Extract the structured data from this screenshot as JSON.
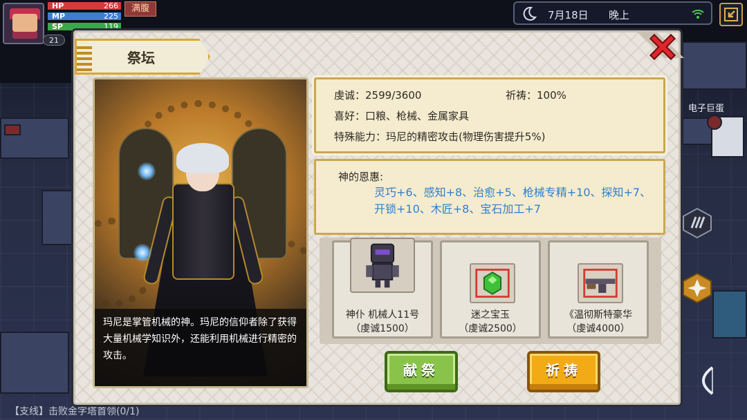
{
  "hud": {
    "hp_label": "HP",
    "hp_value": "266",
    "mp_label": "MP",
    "mp_value": "225",
    "sp_label": "SP",
    "sp_value": "119",
    "level": "21",
    "status": "满腹"
  },
  "datebar": {
    "date": "7月18日",
    "time": "晚上"
  },
  "side": {
    "label": "电子巨蛋"
  },
  "quest": {
    "text": "【支线】击败金字塔首领(0/1)"
  },
  "dialog": {
    "title": "祭坛",
    "description": "玛尼是掌管机械的神。玛尼的信仰者除了获得大量机械学知识外，还能利用机械进行精密的攻击。",
    "info": {
      "devotion_label": "虔诚：",
      "devotion_value": "2599/3600",
      "prayer_label": "祈祷：",
      "prayer_value": "100%",
      "likes_label": "喜好：",
      "likes_value": "口粮、枪械、金属家具",
      "ability_label": "特殊能力：",
      "ability_value": "玛尼的精密攻击(物理伤害提升5%)"
    },
    "blessing": {
      "title": "神的恩惠:",
      "text": "灵巧+6、感知+8、治愈+5、枪械专精+10、探知+7、开锁+10、木匠+8、宝石加工+7"
    },
    "rewards": [
      {
        "name": "神仆 机械人11号",
        "cost": "（虔诚1500）",
        "icon": "robot-icon"
      },
      {
        "name": "迷之宝玉",
        "cost": "（虔诚2500）",
        "icon": "green-gem-icon"
      },
      {
        "name": "《温彻斯特豪华",
        "cost": "（虔诚4000）",
        "icon": "rifle-icon"
      }
    ],
    "buttons": {
      "offer": "献祭",
      "pray": "祈祷"
    }
  },
  "colors": {
    "offer_button": "#8ac34a",
    "pray_button": "#f2ab16",
    "blessing_text": "#2f7fcf",
    "panel_border": "#c9a752"
  }
}
